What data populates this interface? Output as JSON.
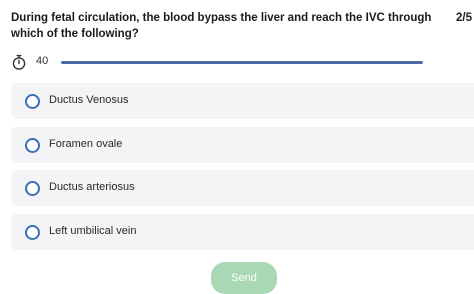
{
  "question": {
    "text": "During fetal circulation, the blood bypass the liver and reach the IVC through which of the following?",
    "counter": "2/5"
  },
  "timer": {
    "icon": "stopwatch-icon",
    "value": "40",
    "progress_fraction": 1.0,
    "bar_color": "#4a6aa8"
  },
  "options": [
    {
      "label": "Ductus Venosus"
    },
    {
      "label": "Foramen ovale"
    },
    {
      "label": "Ductus arteriosus"
    },
    {
      "label": "Left umbilical vein"
    }
  ],
  "send_button": {
    "label": "Send"
  },
  "colors": {
    "radio_accent": "#3d6fb6",
    "option_background": "#f4f4f6",
    "send_button": "#a9d8b4"
  }
}
